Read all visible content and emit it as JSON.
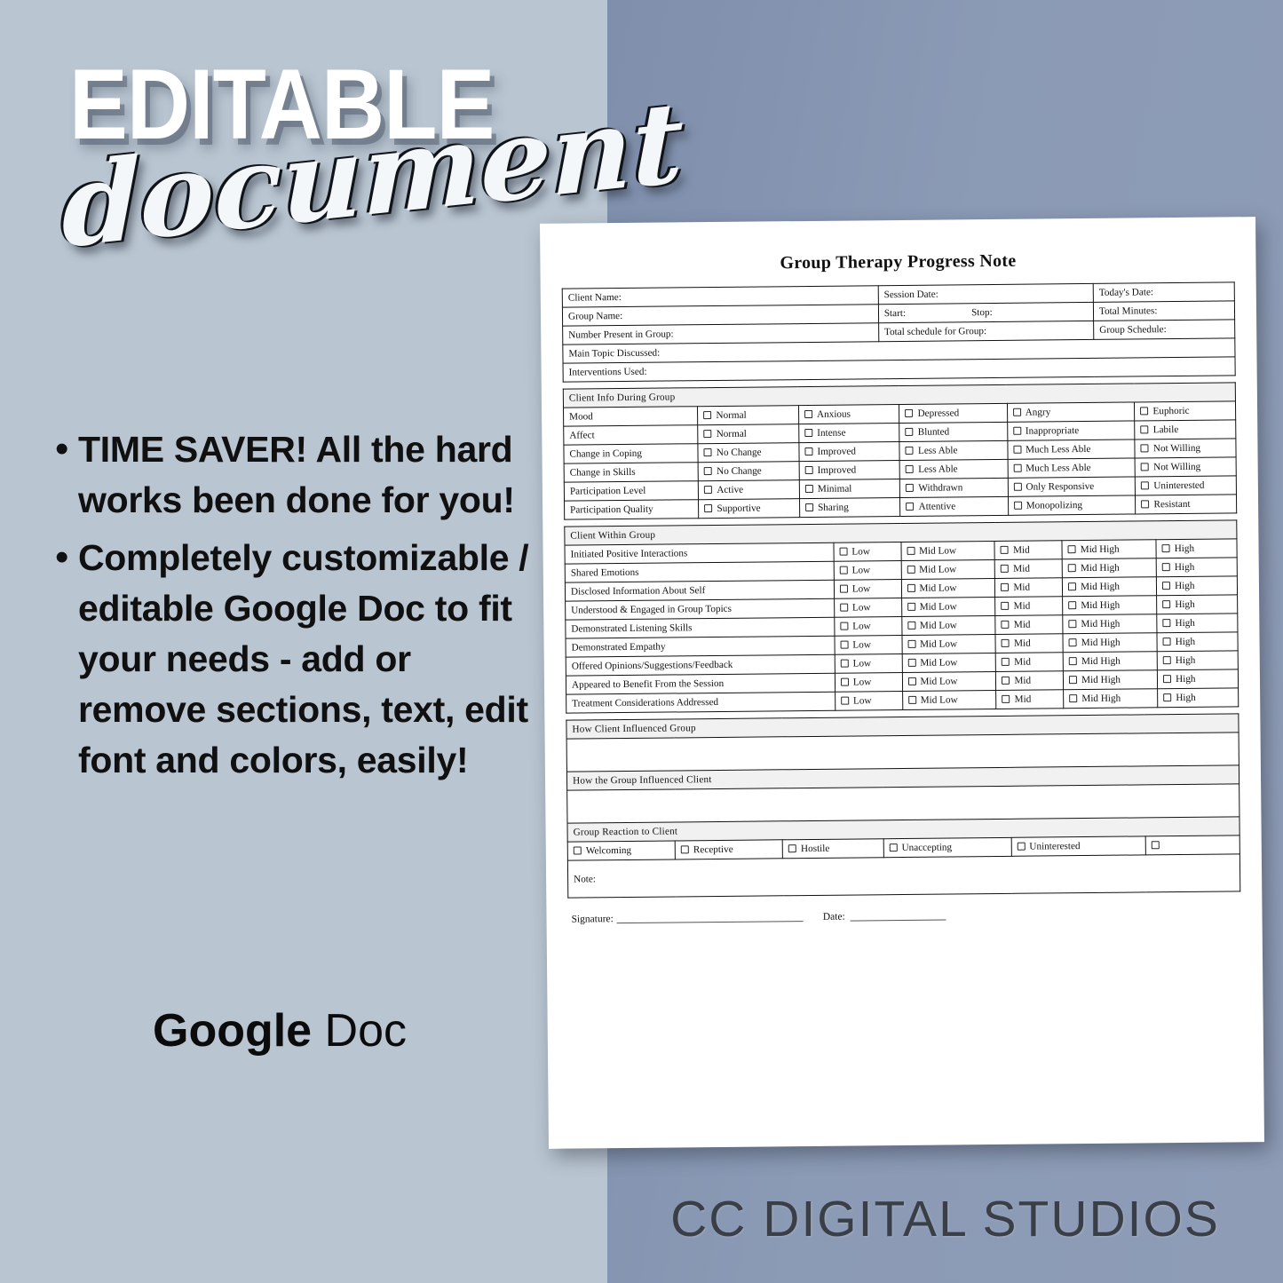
{
  "theme": {
    "left_panel_color": "#b9c5d1",
    "right_panel_color": "#8b9ab5",
    "sheet_color": "#ffffff",
    "section_header_fill": "#f1f1f1",
    "ink_color": "#111111",
    "brand_text_color": "#3a3f47"
  },
  "promo": {
    "title_line1": "EDITABLE",
    "title_line2": "document",
    "bullets": [
      "TIME SAVER!  All the hard works been done for you!",
      "Completely customizable / editable Google Doc to fit your needs - add or remove sections, text, edit font and colors, easily!"
    ],
    "format_bold": "Google",
    "format_regular": " Doc",
    "bullet_glyph": "•"
  },
  "brand": {
    "name": "CC DIGITAL STUDIOS"
  },
  "document": {
    "title": "Group Therapy Progress Note",
    "header_table": {
      "rows": [
        {
          "cells": [
            "Client Name:",
            "Session Date:",
            "Today's Date:"
          ]
        },
        {
          "cells": [
            "Group Name:",
            "Start:|Stop:",
            "Total Minutes:"
          ]
        },
        {
          "cells": [
            "Number Present in Group:",
            "Total schedule for Group:",
            "Group Schedule:"
          ]
        }
      ],
      "full_width_rows": [
        "Main Topic Discussed:",
        "Interventions Used:"
      ]
    },
    "client_info_during_group": {
      "section_title": "Client Info During Group",
      "rows": [
        {
          "label": "Mood",
          "options": [
            "Normal",
            "Anxious",
            "Depressed",
            "Angry",
            "Euphoric"
          ]
        },
        {
          "label": "Affect",
          "options": [
            "Normal",
            "Intense",
            "Blunted",
            "Inappropriate",
            "Labile"
          ]
        },
        {
          "label": "Change in Coping",
          "options": [
            "No Change",
            "Improved",
            "Less Able",
            "Much Less Able",
            "Not Willing"
          ]
        },
        {
          "label": "Change in Skills",
          "options": [
            "No Change",
            "Improved",
            "Less Able",
            "Much Less Able",
            "Not Willing"
          ]
        },
        {
          "label": "Participation Level",
          "options": [
            "Active",
            "Minimal",
            "Withdrawn",
            "Only Responsive",
            "Uninterested"
          ]
        },
        {
          "label": "Participation Quality",
          "options": [
            "Supportive",
            "Sharing",
            "Attentive",
            "Monopolizing",
            "Resistant"
          ]
        }
      ]
    },
    "client_within_group": {
      "section_title": "Client Within Group",
      "scale": [
        "Low",
        "Mid Low",
        "Mid",
        "Mid High",
        "High"
      ],
      "rows": [
        "Initiated Positive Interactions",
        "Shared Emotions",
        "Disclosed Information About Self",
        "Understood & Engaged in Group Topics",
        "Demonstrated Listening Skills",
        "Demonstrated Empathy",
        "Offered Opinions/Suggestions/Feedback",
        "Appeared to Benefit From the Session",
        "Treatment Considerations Addressed"
      ]
    },
    "narrative_sections": [
      {
        "title": "How Client Influenced Group",
        "body": ""
      },
      {
        "title": "How the Group Influenced Client",
        "body": ""
      }
    ],
    "group_reaction": {
      "section_title": "Group Reaction to Client",
      "options": [
        "Welcoming",
        "Receptive",
        "Hostile",
        "Unaccepting",
        "Uninterested",
        ""
      ],
      "note_label": "Note:"
    },
    "signature_block": {
      "signature_label": "Signature:",
      "date_label": "Date:"
    }
  }
}
